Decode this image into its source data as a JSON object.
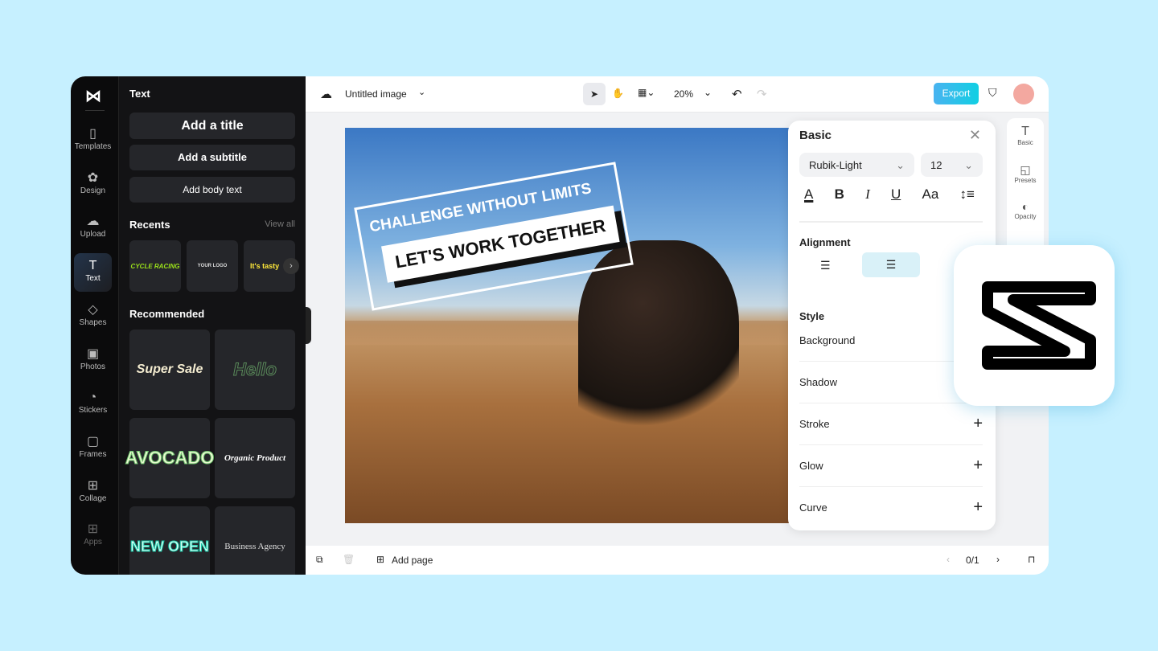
{
  "rail": {
    "items": [
      {
        "label": "Templates",
        "icon": "templates-icon"
      },
      {
        "label": "Design",
        "icon": "design-icon"
      },
      {
        "label": "Upload",
        "icon": "upload-icon"
      },
      {
        "label": "Text",
        "icon": "text-icon"
      },
      {
        "label": "Shapes",
        "icon": "shapes-icon"
      },
      {
        "label": "Photos",
        "icon": "photos-icon"
      },
      {
        "label": "Stickers",
        "icon": "stickers-icon"
      },
      {
        "label": "Frames",
        "icon": "frames-icon"
      },
      {
        "label": "Collage",
        "icon": "collage-icon"
      },
      {
        "label": "Apps",
        "icon": "apps-icon"
      }
    ]
  },
  "panel": {
    "title": "Text",
    "add_title": "Add a title",
    "add_subtitle": "Add a subtitle",
    "add_body": "Add body text",
    "recents": "Recents",
    "view_all": "View all",
    "recent_items": [
      "CYCLE RACING",
      "YOUR LOGO",
      "It's tasty"
    ],
    "recommended": "Recommended",
    "rec_items": [
      "Super Sale",
      "Hello",
      "AVOCADO",
      "Organic Product",
      "NEW OPEN",
      "Business Agency"
    ]
  },
  "top": {
    "doc_title": "Untitled image",
    "zoom": "20%",
    "export": "Export"
  },
  "canvas": {
    "line1": "CHALLENGE WITHOUT LIMITS",
    "line2": "LET'S WORK TOGETHER"
  },
  "props": {
    "title": "Basic",
    "font": "Rubik-Light",
    "size": "12",
    "alignment": "Alignment",
    "style": "Style",
    "rows": [
      "Background",
      "Shadow",
      "Stroke",
      "Glow",
      "Curve"
    ]
  },
  "right_rail": [
    "Basic",
    "Presets",
    "Opacity"
  ],
  "bottom": {
    "add_page": "Add page",
    "page": "0/1"
  },
  "colors": {
    "export": "#1ec8e6",
    "bg": "#c6f0ff"
  }
}
